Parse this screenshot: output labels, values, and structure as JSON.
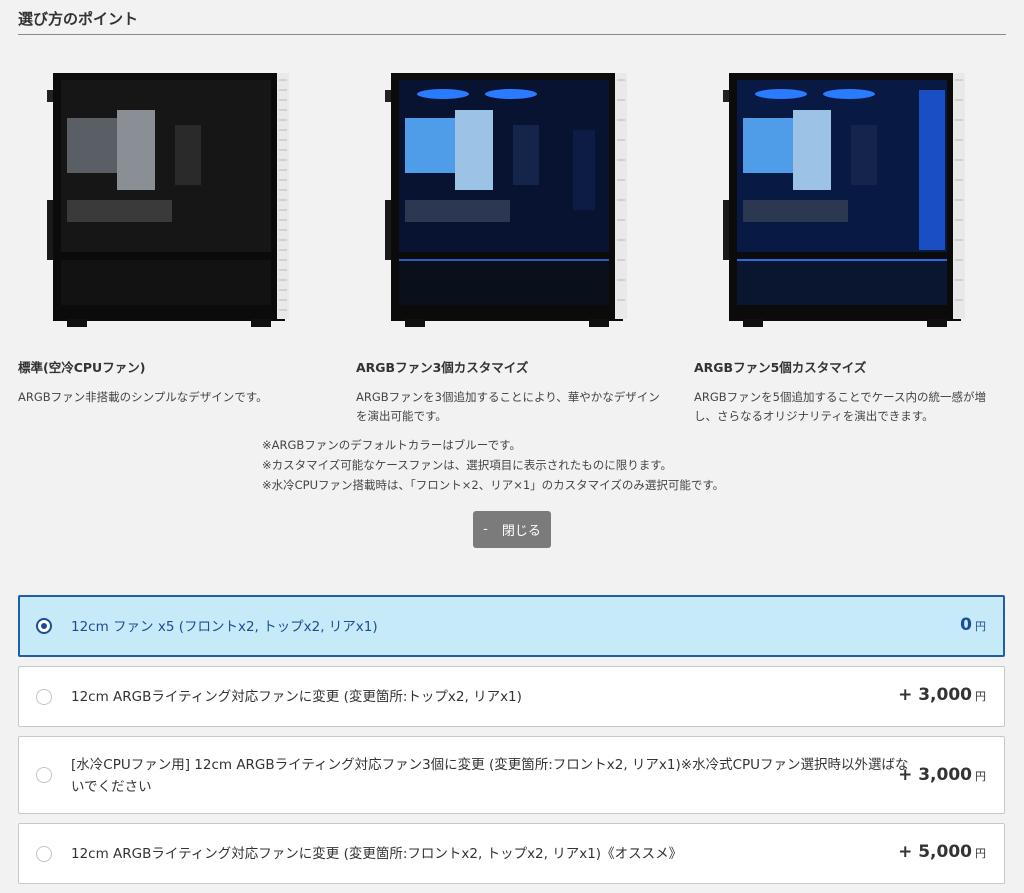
{
  "section": {
    "title": "選び方のポイント"
  },
  "options": [
    {
      "name": "標準(空冷CPUファン)",
      "desc": "ARGBファン非搭載のシンプルなデザインです。",
      "lighting": "none"
    },
    {
      "name": "ARGBファン3個カスタマイズ",
      "desc": "ARGBファンを3個追加することにより、華やかなデザインを演出可能です。",
      "lighting": "blue3"
    },
    {
      "name": "ARGBファン5個カスタマイズ",
      "desc": "ARGBファンを5個追加することでケース内の統一感が増し、さらなるオリジナリティを演出できます。",
      "lighting": "blue5"
    }
  ],
  "notes": [
    "※ARGBファンのデフォルトカラーはブルーです。",
    "※カスタマイズ可能なケースファンは、選択項目に表示されたものに限ります。",
    "※水冷CPUファン搭載時は、「フロント×2、リア×1」のカスタマイズのみ選択可能です。"
  ],
  "close_button": {
    "icon": "-",
    "label": "閉じる"
  },
  "choices": [
    {
      "label": "12cm ファン x5 (フロントx2, トップx2, リアx1)",
      "price": "0",
      "yen": "円",
      "selected": true
    },
    {
      "label": "12cm ARGBライティング対応ファンに変更 (変更箇所:トップx2, リアx1)",
      "price": "+ 3,000",
      "yen": "円",
      "selected": false
    },
    {
      "label": "[水冷CPUファン用] 12cm ARGBライティング対応ファン3個に変更 (変更箇所:フロントx2, リアx1)※水冷式CPUファン選択時以外選ばないでください",
      "price": "+ 3,000",
      "yen": "円",
      "selected": false
    },
    {
      "label": "12cm ARGBライティング対応ファンに変更 (変更箇所:フロントx2, トップx2, リアx1)《オススメ》",
      "price": "+ 5,000",
      "yen": "円",
      "selected": false
    }
  ],
  "colors": {
    "selected_bg": "#c6eaf8",
    "selected_border": "#1f5fa8",
    "argb_blue": "#2a7bff",
    "button_bg": "#7b7b7b"
  }
}
